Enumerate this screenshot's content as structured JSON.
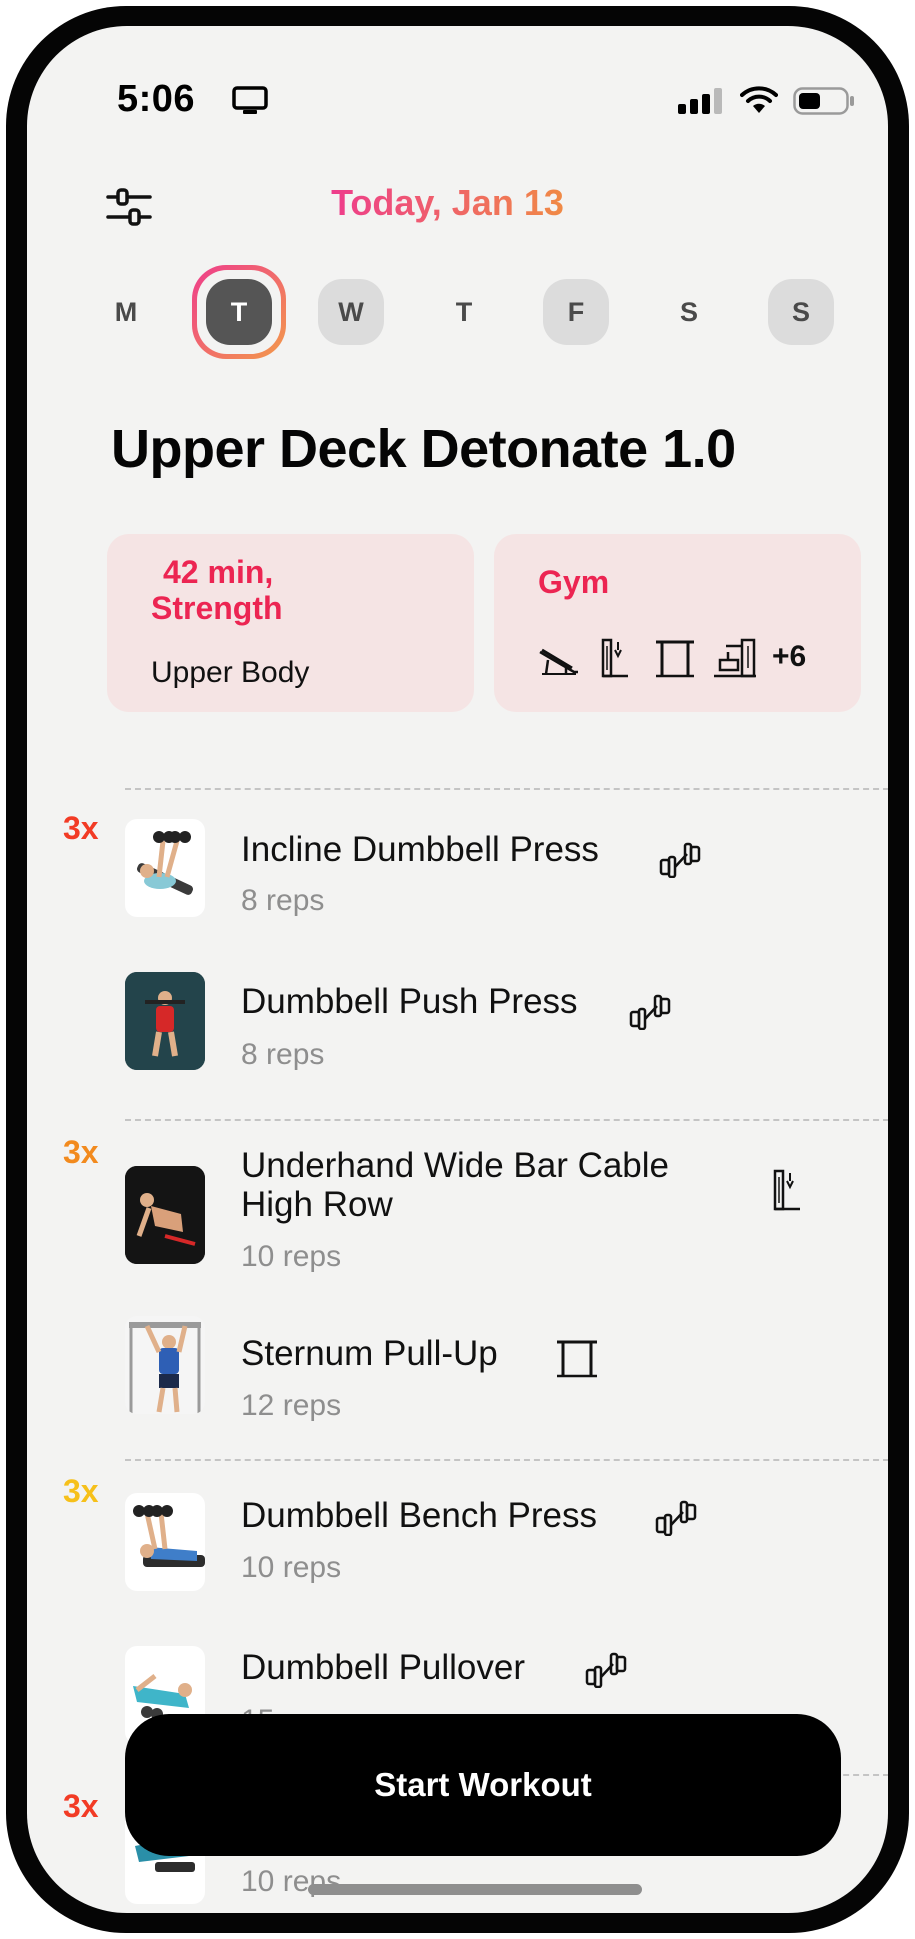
{
  "status_bar": {
    "time": "5:06"
  },
  "header": {
    "date": "Today, Jan 13"
  },
  "week": {
    "days": [
      {
        "letter": "M"
      },
      {
        "letter": "T"
      },
      {
        "letter": "W"
      },
      {
        "letter": "T"
      },
      {
        "letter": "F"
      },
      {
        "letter": "S"
      },
      {
        "letter": "S"
      }
    ]
  },
  "workout": {
    "title": "Upper Deck Detonate 1.0",
    "summary": {
      "duration": "42 min,",
      "type": "Strength",
      "focus": "Upper Body"
    },
    "location": {
      "name": "Gym",
      "more_equipment": "+6"
    }
  },
  "rounds": [
    {
      "label": "3x",
      "color": "#f23b25"
    },
    {
      "label": "3x",
      "color": "#f28a1e"
    },
    {
      "label": "3x",
      "color": "#f6c01a"
    },
    {
      "label": "3x",
      "color": "#f23b25"
    }
  ],
  "exercises": [
    {
      "name": "Incline Dumbbell Press",
      "reps": "8 reps",
      "equipment_icon": "dumbbell-icon"
    },
    {
      "name": "Dumbbell Push Press",
      "reps": "8 reps",
      "equipment_icon": "dumbbell-icon"
    },
    {
      "name_line1": "Underhand Wide Bar Cable",
      "name_line2": "High Row",
      "reps": "10 reps",
      "equipment_icon": "cable-machine-icon"
    },
    {
      "name": "Sternum Pull-Up",
      "reps": "12 reps",
      "equipment_icon": "pull-up-bar-icon"
    },
    {
      "name": "Dumbbell Bench Press",
      "reps": "10 reps",
      "equipment_icon": "dumbbell-icon"
    },
    {
      "name": "Dumbbell Pullover",
      "reps": "15 reps",
      "equipment_icon": "dumbbell-icon"
    },
    {
      "name": "",
      "reps": "10 reps"
    }
  ],
  "actions": {
    "start": "Start Workout"
  },
  "colors": {
    "accent_pink": "#ec2552",
    "card_bg": "#f5e4e4",
    "gradient_start": "#ee3c8c",
    "gradient_end": "#f08a45"
  }
}
